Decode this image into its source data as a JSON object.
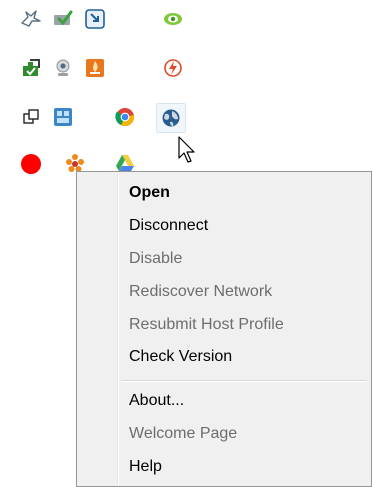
{
  "tray": {
    "icons": [
      "bird-outline-icon",
      "monitor-check-icon",
      "blue-shortcut-icon",
      "nvidia-eye-icon",
      "green-puzzle-icon",
      "webcam-icon",
      "orange-flame-app-icon",
      "power-bolt-icon",
      "window-switch-icon",
      "blue-grid-app-icon",
      "chrome-icon",
      "network-globe-icon",
      "red-record-icon",
      "orange-flower-icon",
      "drive-triangle-icon"
    ]
  },
  "cursor": {
    "icon": "arrow-cursor-icon"
  },
  "context_menu": {
    "items": [
      {
        "label": "Open",
        "enabled": true,
        "default": true
      },
      {
        "label": "Disconnect",
        "enabled": true
      },
      {
        "label": "Disable",
        "enabled": false
      },
      {
        "label": "Rediscover Network",
        "enabled": false
      },
      {
        "label": "Resubmit Host Profile",
        "enabled": false
      },
      {
        "label": "Check Version",
        "enabled": true
      },
      {
        "label": "About...",
        "enabled": true
      },
      {
        "label": "Welcome Page",
        "enabled": false
      },
      {
        "label": "Help",
        "enabled": true
      }
    ]
  },
  "colors": {
    "menu_background": "#f0f0f0",
    "menu_border": "#979797",
    "text_enabled": "#000000",
    "text_disabled": "#6d6d6d"
  }
}
